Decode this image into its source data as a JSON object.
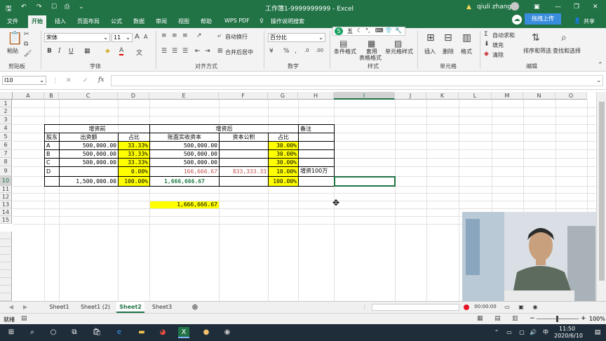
{
  "window": {
    "title": "工作簿1-9999999999  -  Excel",
    "user": "qiuli zhang",
    "qat_icons": [
      "save-icon",
      "undo-icon",
      "redo-icon",
      "checkbox-icon",
      "print-preview-icon",
      "customize-icon"
    ],
    "controls": [
      "ribbon-display-icon",
      "minimize-icon",
      "restore-icon",
      "close-icon"
    ]
  },
  "ribbon_tabs": [
    "文件",
    "开始",
    "插入",
    "页面布局",
    "公式",
    "数据",
    "审阅",
    "视图",
    "帮助",
    "WPS PDF"
  ],
  "active_tab": "开始",
  "tell_me": "操作说明搜索",
  "share": "共享",
  "upload_label": "拖拽上传",
  "ribbon": {
    "clipboard": {
      "paste": "粘贴",
      "group": "剪贴板"
    },
    "font": {
      "name": "宋体",
      "size": "11",
      "bold": "B",
      "italic": "I",
      "underline": "U",
      "grow": "A",
      "shrink": "A",
      "color_a": "A",
      "group": "字体"
    },
    "align": {
      "wrap": "自动换行",
      "merge": "合并后居中",
      "group": "对齐方式"
    },
    "number": {
      "format": "百分比",
      "group": "数字"
    },
    "styles": {
      "cond": "条件格式",
      "table1": "套用",
      "table2": "表格格式",
      "cell": "单元格样式",
      "group": "样式"
    },
    "cells": {
      "insert": "插入",
      "delete": "删除",
      "format": "格式",
      "group": "单元格"
    },
    "editing": {
      "autosum": "自动求和",
      "fill": "填充",
      "clear": "清除",
      "sort": "排序和筛选",
      "find": "查找和选择",
      "group": "编辑"
    }
  },
  "formula_bar": {
    "name_box": "I10",
    "fx": "fx",
    "value": ""
  },
  "columns": [
    "A",
    "B",
    "C",
    "D",
    "E",
    "F",
    "G",
    "H",
    "I",
    "J",
    "K",
    "L",
    "M",
    "N",
    "O"
  ],
  "rows": [
    "1",
    "2",
    "3",
    "4",
    "5",
    "6",
    "7",
    "8",
    "9",
    "10",
    "11",
    "12",
    "13",
    "14",
    "15"
  ],
  "table": {
    "before": "增资前",
    "after": "增资后",
    "note": "备注",
    "h_holder": "股东",
    "h_contrib": "出资额",
    "h_ratio": "占比",
    "h_book": "账面实收资本",
    "h_reserve": "资本公积",
    "h_ratio2": "占比",
    "rows": [
      {
        "holder": "A",
        "contrib": "500,000.00",
        "ratio": "33.33%",
        "book": "500,000.00",
        "reserve": "",
        "ratio2": "30.00%",
        "note": ""
      },
      {
        "holder": "B",
        "contrib": "500,000.00",
        "ratio": "33.33%",
        "book": "500,000.00",
        "reserve": "",
        "ratio2": "30.00%",
        "note": ""
      },
      {
        "holder": "C",
        "contrib": "500,000.00",
        "ratio": "33.33%",
        "book": "500,000.00",
        "reserve": "",
        "ratio2": "30.00%",
        "note": ""
      },
      {
        "holder": "D",
        "contrib": "",
        "ratio": "0.00%",
        "book": "166,666.67",
        "reserve": "833,333.33",
        "ratio2": "10.00%",
        "note": "增资100万"
      }
    ],
    "total": {
      "contrib": "1,500,000.00",
      "ratio": "100.00%",
      "book": "1,666,666.67",
      "ratio2": "100.00%"
    },
    "e13": "1,666,666.67"
  },
  "sheets": [
    "Sheet1",
    "Sheet1 (2)",
    "Sheet2",
    "Sheet3"
  ],
  "active_sheet": "Sheet2",
  "recording_time": "00:00:00",
  "status": {
    "ready": "就绪",
    "zoom": "100%"
  },
  "taskbar": {
    "time": "11:50",
    "date": "2020/6/10",
    "lang": "中"
  },
  "colors": {
    "excel_green": "#217346",
    "highlight": "#ffff00",
    "red_text": "#c0504d",
    "green_text": "#1e7b45"
  }
}
